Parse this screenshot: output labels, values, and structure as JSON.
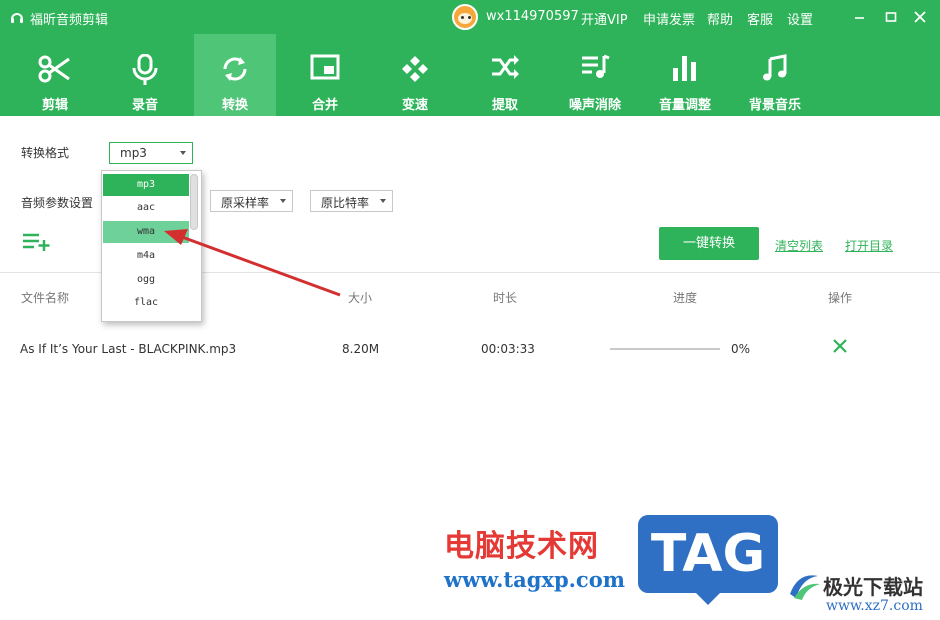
{
  "app": {
    "title": "福昕音频剪辑"
  },
  "header": {
    "username": "wx114970597",
    "links": [
      "开通VIP",
      "申请发票",
      "帮助",
      "客服",
      "设置"
    ]
  },
  "toolbar": {
    "active": "转换",
    "tools": [
      {
        "label": "剪辑",
        "icon": "scissors-icon"
      },
      {
        "label": "录音",
        "icon": "microphone-icon"
      },
      {
        "label": "转换",
        "icon": "convert-icon"
      },
      {
        "label": "合并",
        "icon": "merge-icon"
      },
      {
        "label": "变速",
        "icon": "speed-icon"
      },
      {
        "label": "提取",
        "icon": "extract-icon"
      },
      {
        "label": "噪声消除",
        "icon": "noise-removal-icon"
      },
      {
        "label": "音量调整",
        "icon": "volume-icon"
      },
      {
        "label": "背景音乐",
        "icon": "music-note-icon"
      }
    ]
  },
  "settings": {
    "format_label": "转换格式",
    "format_value": "mp3",
    "params_label": "音频参数设置",
    "sample_rate": "原采样率",
    "bitrate": "原比特率",
    "format_options": [
      "mp3",
      "aac",
      "wma",
      "m4a",
      "ogg",
      "flac"
    ],
    "selected_option": "mp3",
    "hover_option": "wma"
  },
  "actions": {
    "convert_button": "一键转换",
    "clear_list": "清空列表",
    "open_folder": "打开目录"
  },
  "table": {
    "headers": [
      "文件名称",
      "大小",
      "时长",
      "进度",
      "操作"
    ],
    "rows": [
      {
        "name": "As If It’s Your Last - BLACKPINK.mp3",
        "size": "8.20M",
        "duration": "00:03:33",
        "progress_text": "0%",
        "progress": 0
      }
    ]
  },
  "watermark": {
    "cn": "电脑技术网",
    "url": "www.tagxp.com",
    "tag": "TAG",
    "site_cn": "极光下载站",
    "site_url": "www.xz7.com"
  },
  "colors": {
    "brand": "#2eb35a",
    "arrow": "#d32f2f"
  }
}
